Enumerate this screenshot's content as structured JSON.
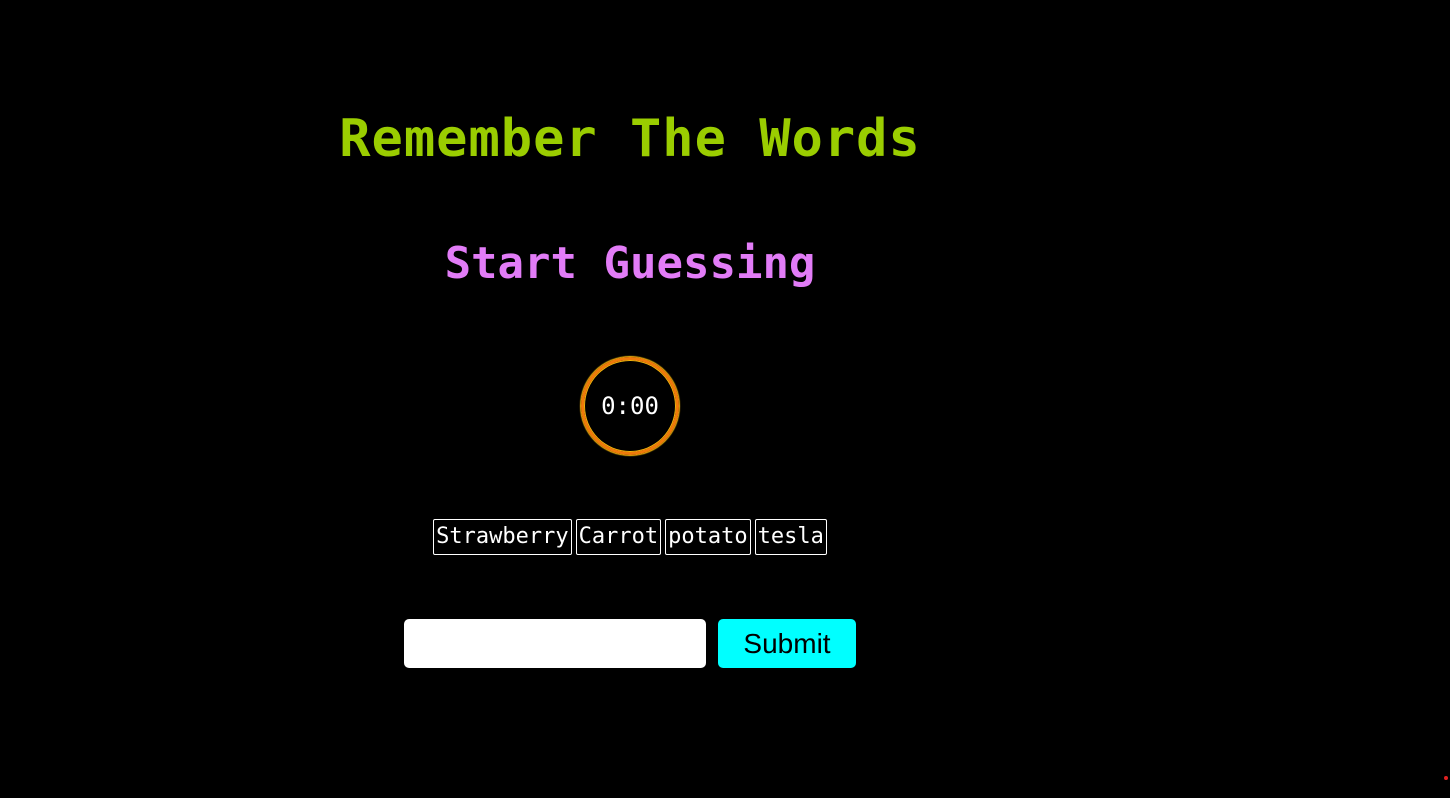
{
  "header": {
    "title": "Remember The Words",
    "subtitle": "Start Guessing"
  },
  "timer": {
    "display": "0:00"
  },
  "words": [
    "Strawberry",
    "Carrot",
    "potato",
    "tesla"
  ],
  "form": {
    "input_value": "",
    "submit_label": "Submit"
  },
  "colors": {
    "title": "#9acd00",
    "subtitle": "#e27cf7",
    "timer_ring": "#ef7a0a",
    "submit_bg": "#00ffff",
    "corner_dot": "#e02020"
  }
}
